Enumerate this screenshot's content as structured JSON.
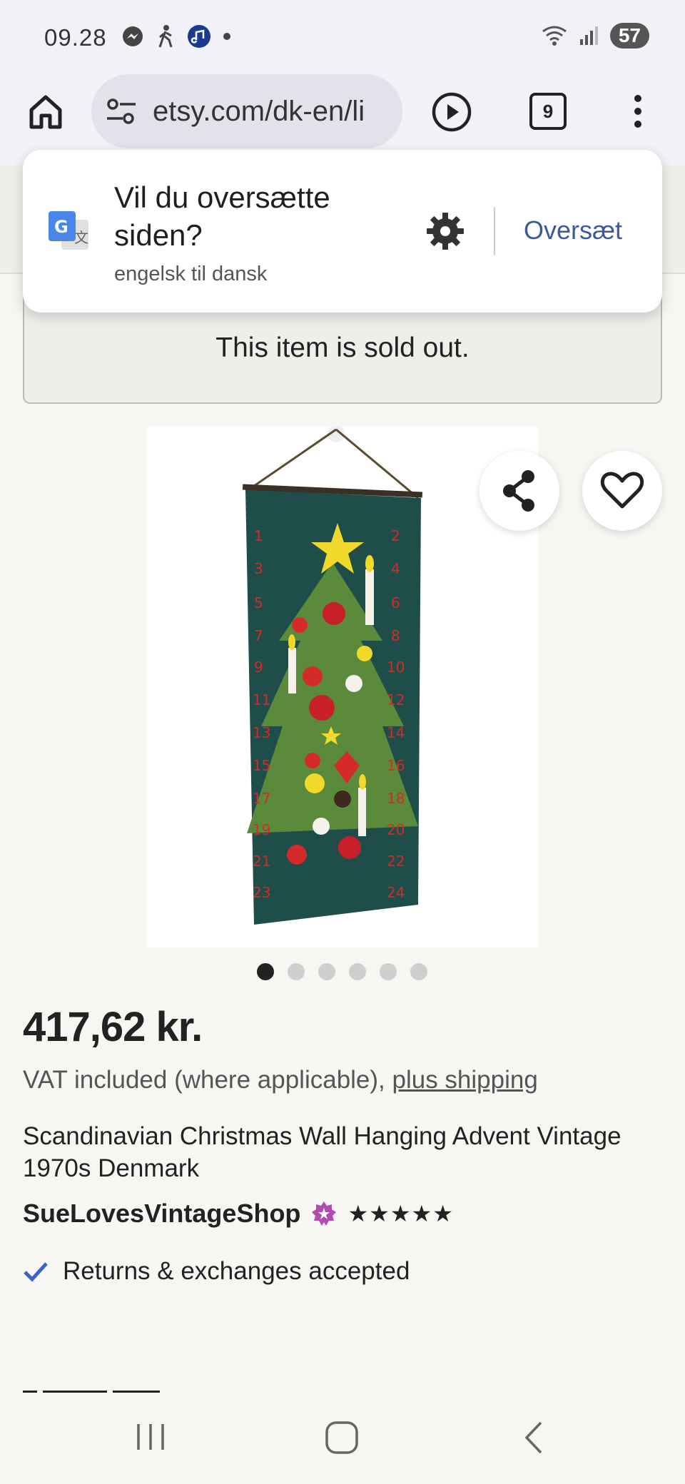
{
  "status_bar": {
    "time": "09.28",
    "battery": "57"
  },
  "browser": {
    "url": "etsy.com/dk-en/li",
    "tab_count": "9"
  },
  "translate_prompt": {
    "title": "Vil du oversætte siden?",
    "subtitle": "engelsk til dansk",
    "action": "Oversæt"
  },
  "notice": {
    "sold_out": "This item is sold out."
  },
  "gallery": {
    "image_count": 6,
    "active_index": 0
  },
  "listing": {
    "price": "417,62 kr.",
    "vat_text": "VAT included (where applicable), ",
    "shipping_link": "plus shipping",
    "title": "Scandinavian Christmas Wall Hanging Advent Vintage 1970s Denmark",
    "shop_name": "SueLovesVintageShop",
    "rating_stars": "★★★★★",
    "rating": 5,
    "returns": "Returns & exchanges accepted"
  },
  "colors": {
    "accent": "#3c5a9a",
    "star_seller": "#b04dae",
    "check": "#3a62c8",
    "felt_green": "#1e4d4a",
    "tree_green": "#5a8a3a"
  }
}
